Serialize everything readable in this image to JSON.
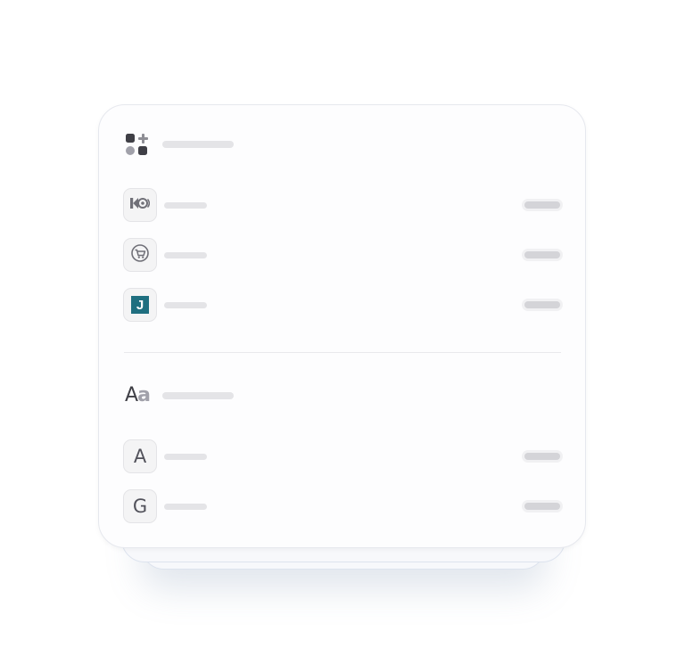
{
  "sections": [
    {
      "id": "apps",
      "icon": "apps-grid-plus-icon",
      "title": "",
      "items": [
        {
          "icon": "kontakt-audio-icon",
          "label": "",
          "value": ""
        },
        {
          "icon": "shopping-cart-refresh-icon",
          "label": "",
          "value": ""
        },
        {
          "icon": "j-logo-icon",
          "label": "",
          "value": ""
        }
      ]
    },
    {
      "id": "fonts",
      "icon": "font-aa-icon",
      "icon_text": {
        "big": "A",
        "small": "a"
      },
      "title": "",
      "items": [
        {
          "icon": "font-a-icon",
          "glyph": "A",
          "label": "",
          "value": ""
        },
        {
          "icon": "font-g-icon",
          "glyph": "G",
          "label": "",
          "value": ""
        }
      ]
    }
  ],
  "j_logo": {
    "glyph": "J",
    "color": "#1f6f80"
  },
  "colors": {
    "card_background": "#fdfdfe",
    "skeleton_bar": "#e4e4e7",
    "pill_bar": "#d4d4d8",
    "icon_dark": "#3f3f46",
    "icon_light": "#a1a1aa"
  }
}
